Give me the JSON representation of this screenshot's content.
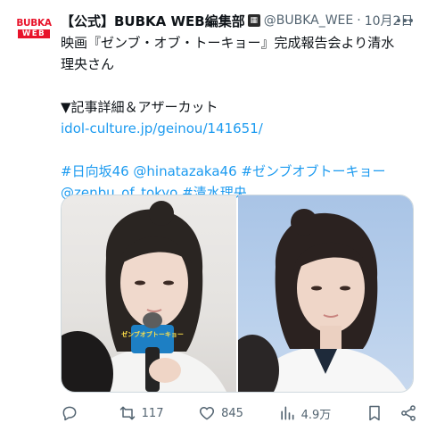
{
  "avatar": {
    "line1": "BUBKA",
    "line2": "WEB"
  },
  "header": {
    "name": "【公式】BUBKA WEB編集部",
    "handle": "@BUBKA_WEE",
    "dot": "·",
    "date": "10月2日"
  },
  "tweet": {
    "line1": "映画『ゼンブ・オブ・トーキョー』完成報告会より清水",
    "line2": "理央さん",
    "line3": "▼記事詳細＆アザーカット",
    "link": "idol-culture.jp/geinou/141651/",
    "hashtags_line1": "#日向坂46 @hinatazaka46 #ゼンブオブトーキョー",
    "hashtags_line2": "@zenbu_of_tokyo #清水理央"
  },
  "media": {
    "mic_sign_text": "ゼンブオブトーキョー"
  },
  "actions": {
    "reply_count": "",
    "retweet_count": "117",
    "like_count": "845",
    "views_count": "4.9万"
  },
  "colors": {
    "link": "#1d9bf0",
    "muted": "#536471",
    "brand_red": "#e8132a"
  }
}
